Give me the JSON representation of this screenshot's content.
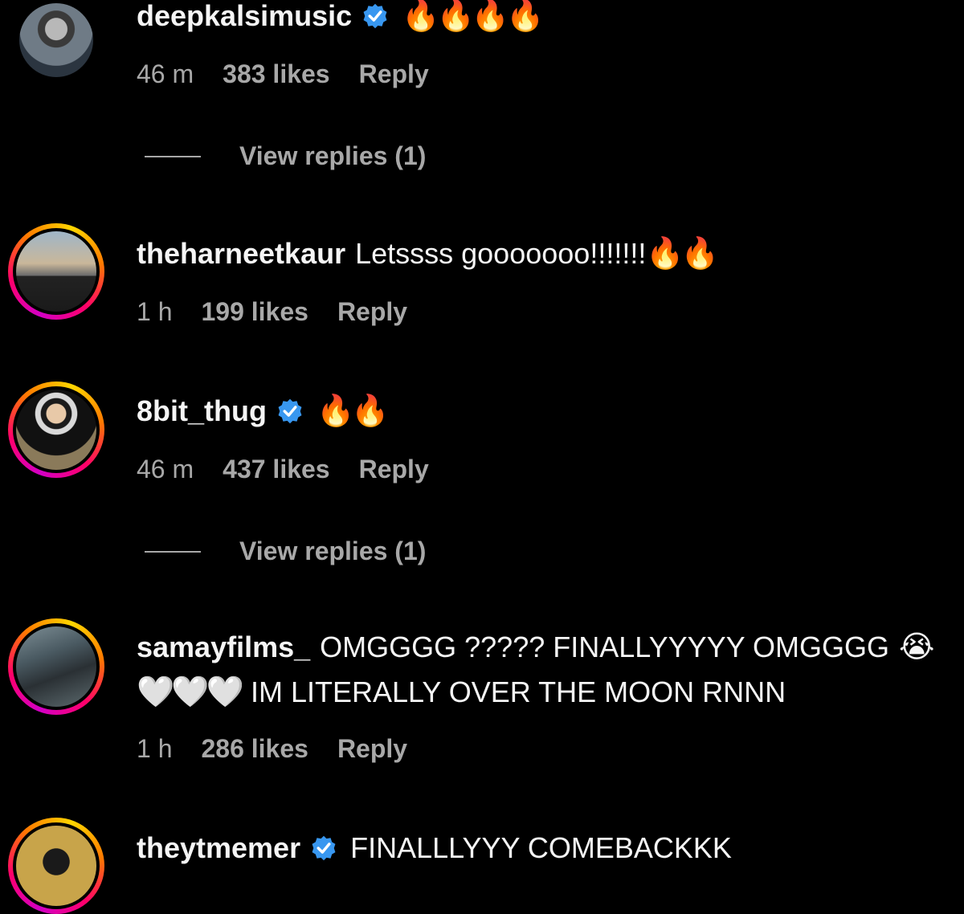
{
  "comments": [
    {
      "username": "deepkalsimusic",
      "verified": true,
      "text": "",
      "emoji": "🔥🔥🔥🔥",
      "time": "46 m",
      "likes": "383 likes",
      "reply": "Reply",
      "view_replies": "View replies (1)"
    },
    {
      "username": "theharneetkaur",
      "verified": false,
      "text": "Letssss gooooooo!!!!!!!",
      "emoji": "🔥🔥",
      "time": "1 h",
      "likes": "199 likes",
      "reply": "Reply"
    },
    {
      "username": "8bit_thug",
      "verified": true,
      "text": "",
      "emoji": "🔥🔥",
      "time": "46 m",
      "likes": "437 likes",
      "reply": "Reply",
      "view_replies": "View replies (1)"
    },
    {
      "username": "samayfilms_",
      "verified": false,
      "text": "OMGGGG ????? FINALLYYYYY OMGGGG",
      "emoji": "😭",
      "line2_emoji": "🤍🤍🤍",
      "line2_text": "IM LITERALLY OVER THE MOON RNNN",
      "time": "1 h",
      "likes": "286 likes",
      "reply": "Reply"
    },
    {
      "username": "theytmemer",
      "verified": true,
      "text": "FINALLLYYY COMEBACKKK"
    }
  ],
  "colors": {
    "background": "#000000",
    "text": "#f5f5f5",
    "secondary_text": "#a8a8a8",
    "verified_badge": "#3897f0"
  }
}
